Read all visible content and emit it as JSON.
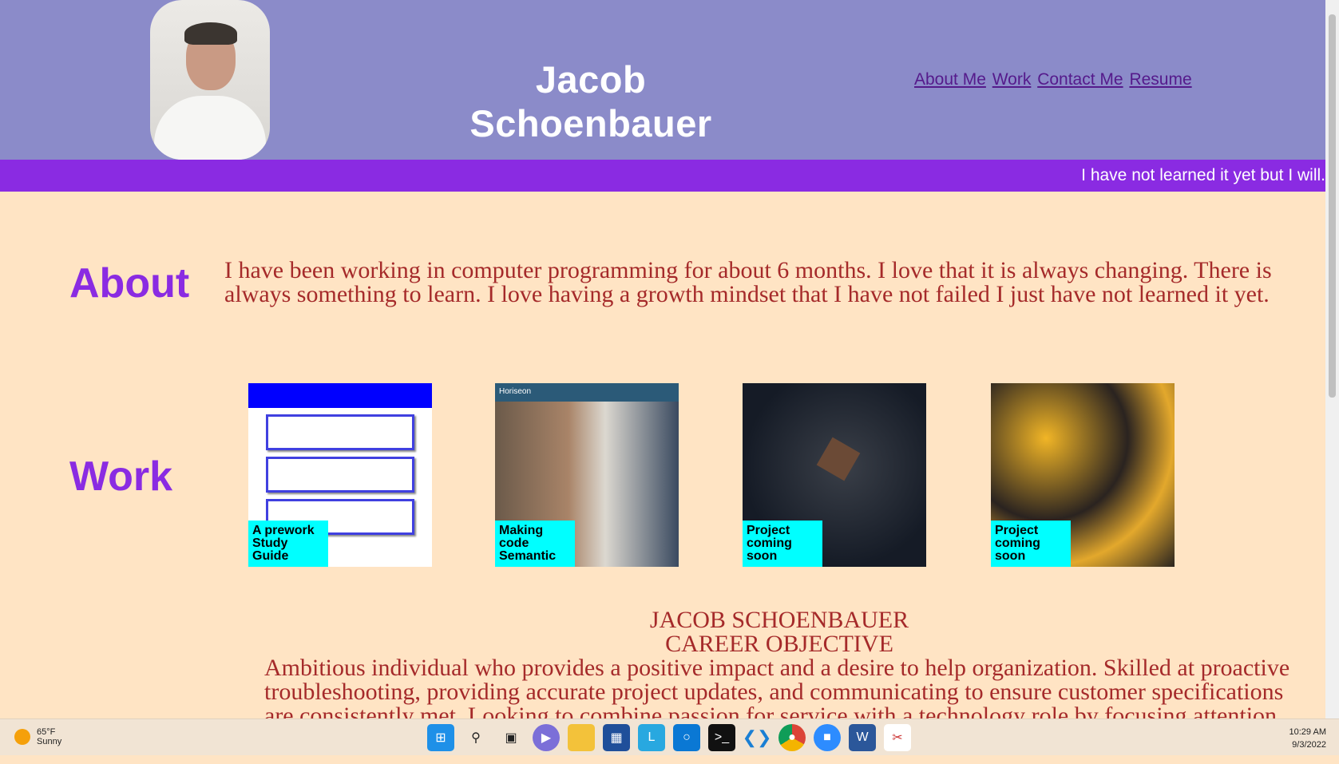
{
  "header": {
    "name": "Jacob Schoenbauer",
    "nav": [
      "About Me",
      "Work",
      "Contact Me",
      "Resume"
    ]
  },
  "banner": "I have not learned it yet but I will.",
  "about": {
    "heading": "About",
    "text": "I have been working in computer programming for about 6 months. I love that it is always changing. There is always something to learn. I love having a growth mindset that I have not failed I just have not learned it yet."
  },
  "work": {
    "heading": "Work",
    "cards": [
      {
        "label": "A prework Study Guide"
      },
      {
        "label": "Making code Semantic",
        "thumb_title": "Horiseon"
      },
      {
        "label": "Project coming soon"
      },
      {
        "label": "Project coming soon"
      }
    ]
  },
  "career": {
    "name": "JACOB SCHOENBAUER",
    "title": "CAREER OBJECTIVE",
    "text": "Ambitious individual who provides a positive impact and a desire to help organization. Skilled at proactive troubleshooting, providing accurate project updates, and communicating to ensure customer specifications are consistently met. Looking to combine passion for service with a technology role by focusing attention"
  },
  "taskbar": {
    "temp": "65°F",
    "weather": "Sunny",
    "time": "10:29 AM",
    "date": "9/3/2022",
    "apps": [
      "windows-start",
      "search",
      "task-view",
      "teams-chat",
      "file-explorer",
      "microsoft-store",
      "app-l",
      "cortana",
      "terminal",
      "vscode",
      "chrome",
      "zoom",
      "word",
      "snipping-tool"
    ]
  },
  "colors": {
    "header": "#8b8bc9",
    "banner": "#8a2be2",
    "background": "#ffe4c4",
    "heading": "#8a2be2",
    "text": "#a52a2a",
    "label": "#00ffff"
  }
}
